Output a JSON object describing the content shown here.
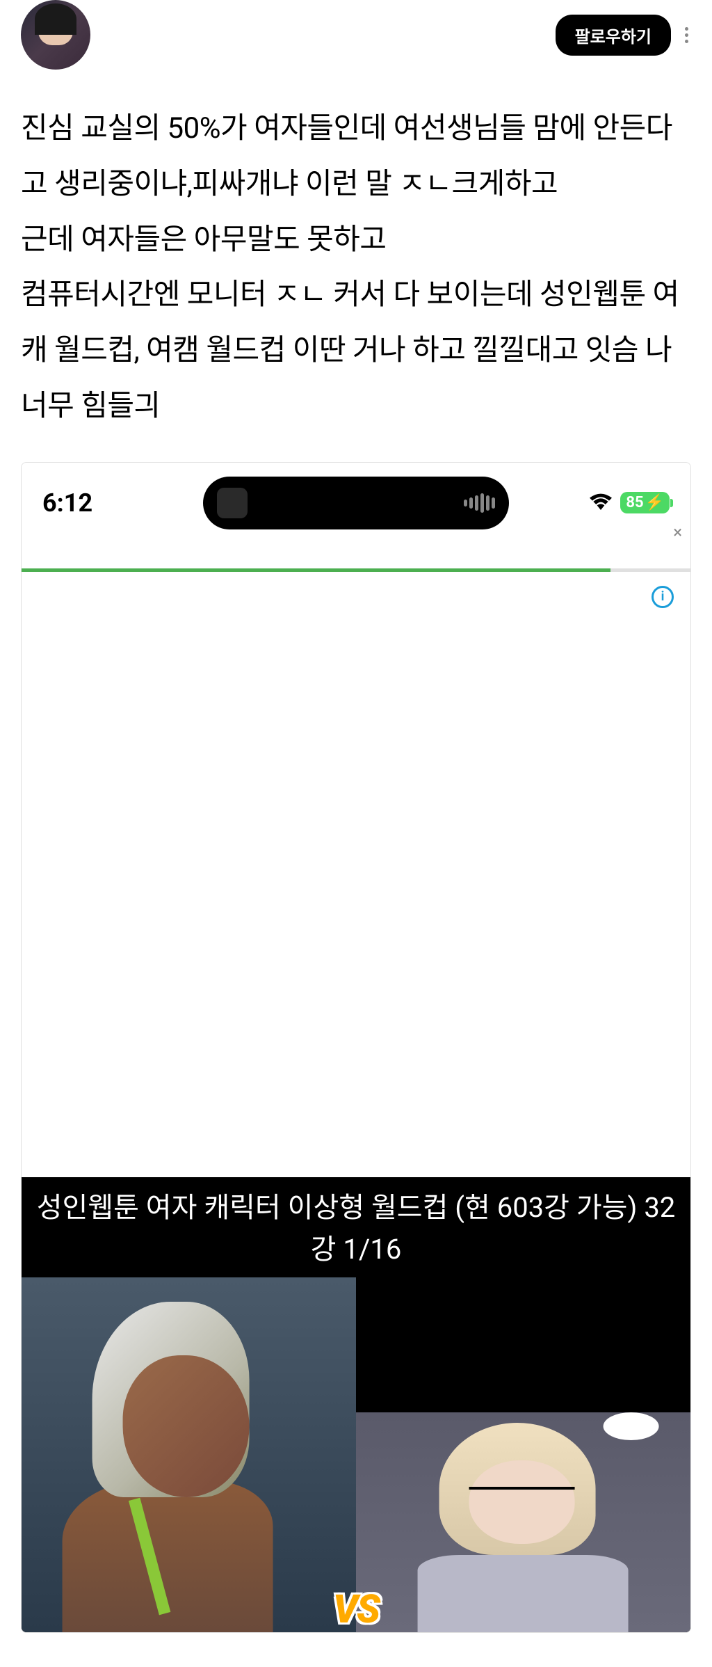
{
  "header": {
    "follow_label": "팔로우하기"
  },
  "post": {
    "body": "진심 교실의 50%가 여자들인데 여선생님들 맘에 안든다고 생리중이냐,피싸개냐 이런 말 ㅈㄴ크게하고\n근데 여자들은 아무말도 못하고\n컴퓨터시간엔 모니터 ㅈㄴ 커서 다 보이는데 성인웹툰 여캐 월드컵, 여캠 월드컵 이딴 거나 하고 낄낄대고 잇슴 나 너무 힘들긔"
  },
  "screenshot": {
    "status_bar": {
      "time": "6:12",
      "battery": "85"
    },
    "close_label": "×",
    "info_label": "i",
    "worldcup": {
      "title": "성인웹툰 여자 캐릭터 이상형 월드컵 (현 603강 가능)   32강   1/16",
      "vs": "VS"
    }
  }
}
